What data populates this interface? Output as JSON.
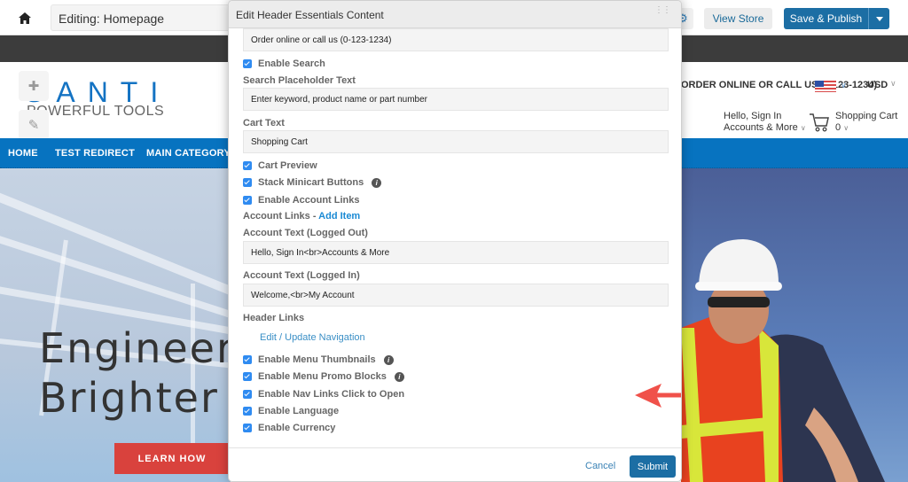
{
  "editor": {
    "page_field": "Editing: Homepage",
    "view_store_label": "View Store",
    "save_publish_label": "Save & Publish"
  },
  "store": {
    "logo_main": "SANTI",
    "logo_sub": "POWERFUL TOOLS",
    "promo_text": "ORDER ONLINE OR CALL US (0-123-1234)",
    "currency": "USD",
    "account_line1": "Hello, Sign In",
    "account_line2": "Accounts & More",
    "cart_line1": "Shopping Cart",
    "cart_count": "0",
    "nav_items": [
      "HOME",
      "TEST REDIRECT",
      "MAIN CATEGORY"
    ],
    "hero_line1": "Engineeri",
    "hero_line2": "Brighter F",
    "hero_button": "LEARN HOW"
  },
  "modal": {
    "title": "Edit Header Essentials Content",
    "promo_field_value": "Order online or call us (0-123-1234)",
    "enable_search": {
      "label": "Enable Search",
      "checked": true
    },
    "search_placeholder_label": "Search Placeholder Text",
    "search_placeholder_value": "Enter keyword, product name or part number",
    "cart_text_label": "Cart Text",
    "cart_text_value": "Shopping Cart",
    "cart_preview": {
      "label": "Cart Preview",
      "checked": true
    },
    "stack_minicart": {
      "label": "Stack Minicart Buttons",
      "checked": true
    },
    "enable_account_links": {
      "label": "Enable Account Links",
      "checked": true
    },
    "account_links_label": "Account Links - ",
    "add_item_label": "Add Item",
    "account_logged_out_label": "Account Text (Logged Out)",
    "account_logged_out_value": "Hello, Sign In<br>Accounts & More",
    "account_logged_in_label": "Account Text (Logged In)",
    "account_logged_in_value": "Welcome,<br>My Account",
    "header_links_label": "Header Links",
    "edit_navigation_label": "Edit / Update Navigation",
    "menu_thumbnails": {
      "label": "Enable Menu Thumbnails",
      "checked": true
    },
    "menu_promo_blocks": {
      "label": "Enable Menu Promo Blocks",
      "checked": true
    },
    "nav_click_open": {
      "label": "Enable Nav Links Click to Open",
      "checked": true
    },
    "enable_language": {
      "label": "Enable Language",
      "checked": true
    },
    "enable_currency": {
      "label": "Enable Currency",
      "checked": true
    },
    "cancel_label": "Cancel",
    "submit_label": "Submit"
  },
  "colors": {
    "primary_blue": "#1c6ea4",
    "nav_blue": "#0773c0",
    "checkbox_blue": "#2f8bf1",
    "annotation_arrow": "#f0514a",
    "cta_red": "#d9423d"
  }
}
